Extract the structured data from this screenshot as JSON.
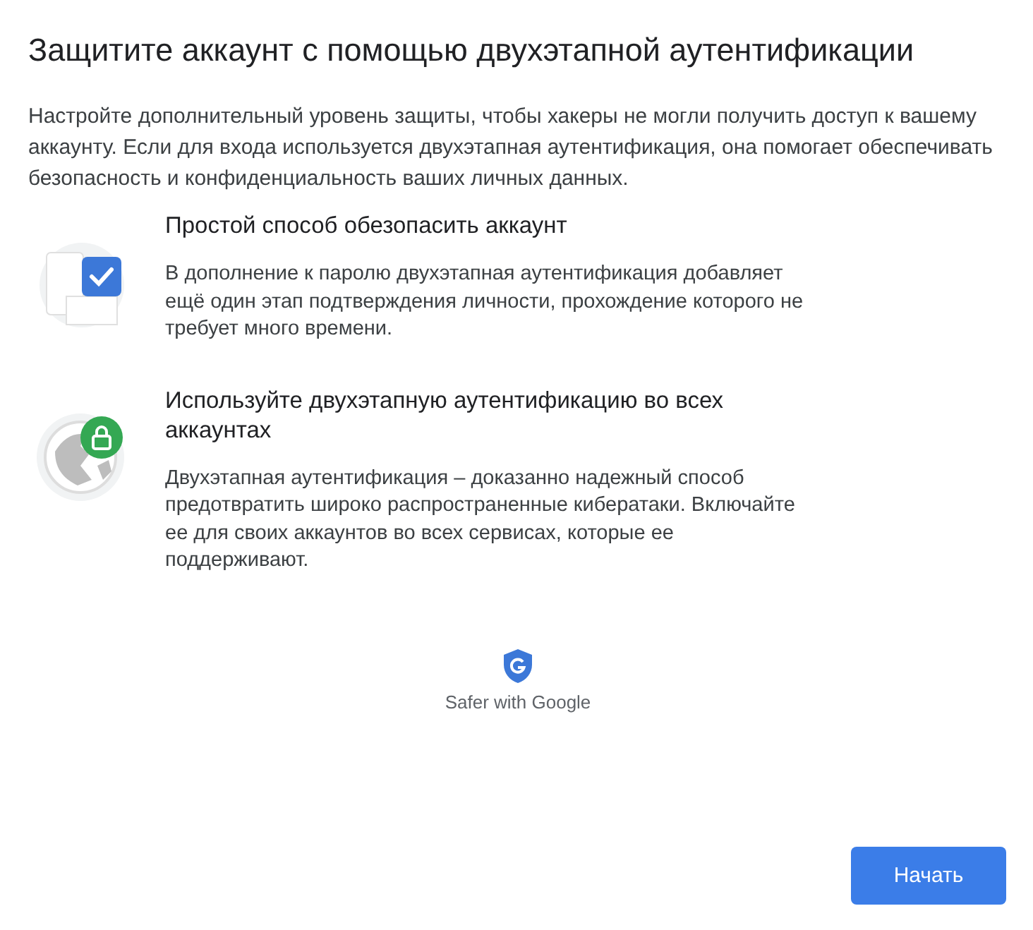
{
  "title": "Защитите аккаунт с помощью двухэтапной аутентификации",
  "intro": "Настройте дополнительный уровень защиты, чтобы хакеры не могли получить доступ к вашему аккаунту. Если для входа используется двухэтапная аутентификация, она помогает обеспечивать безопасность и конфиденциальность ваших личных данных.",
  "features": [
    {
      "kind": "device",
      "title": "Простой способ обезопасить аккаунт",
      "text": "В дополнение к паролю двухэтапная аутентификация добавляет ещё один этап подтверждения личности, прохождение которого не требует много времени."
    },
    {
      "kind": "globe",
      "title": "Используйте двухэтапную аутентификацию во всех аккаунтах",
      "text": "Двухэтапная аутентификация – доказанно надежный способ предотвратить широко распространенные кибератаки. Включайте ее для своих аккаунтов во всех сервисах, которые ее поддерживают."
    }
  ],
  "badge": "Safer with Google",
  "button": "Начать"
}
